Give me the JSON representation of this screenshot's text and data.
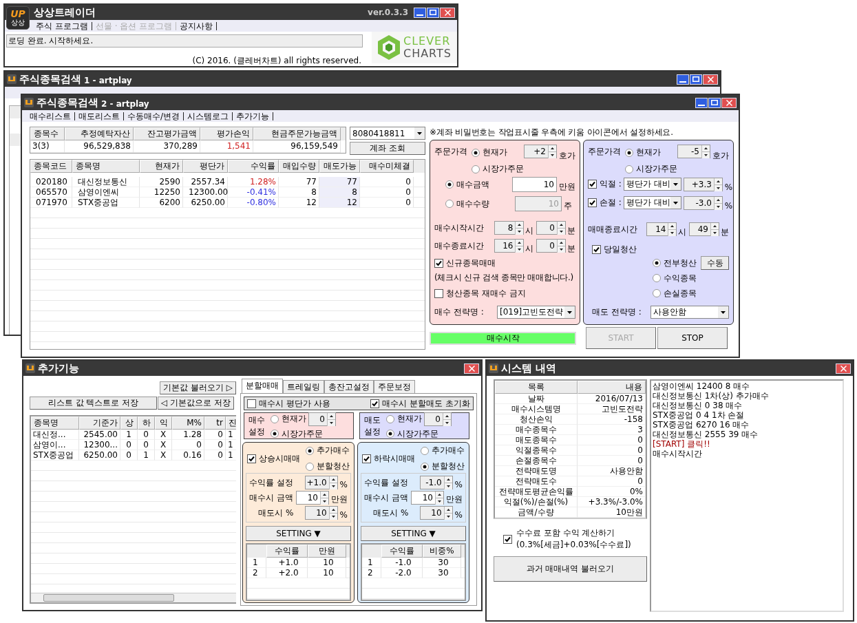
{
  "main_window": {
    "title": "상상트레이더",
    "logo": {
      "mark": "UP",
      "label": "상상"
    },
    "version": "ver.0.3.3",
    "menu": [
      {
        "label": "주식 프로그램",
        "disabled": false
      },
      {
        "label": "선물 · 옵션 프로그램",
        "disabled": true
      },
      {
        "label": "공지사항",
        "disabled": false
      }
    ],
    "status": "로딩 완료. 시작하세요.",
    "copyright": "(C) 2016. (클레버차트) all rights reserved.",
    "brand": [
      "CLEVER",
      "CHARTS"
    ]
  },
  "search_window_1": {
    "title": "주식종목검색",
    "subtitle": "1 - artplay"
  },
  "search_window_2": {
    "title": "주식종목검색",
    "subtitle": "2 - artplay",
    "menu": [
      "매수리스트",
      "매도리스트",
      "수동매수/변경",
      "시스템로그",
      "추가기능"
    ],
    "summary": {
      "columns": [
        "종목수",
        "추정예탁자산",
        "잔고평가금액",
        "평가손익",
        "현금주문가능금액"
      ],
      "values": [
        {
          "text": "3(3)",
          "color": "#000000"
        },
        {
          "text": "96,529,838",
          "color": "#000000"
        },
        {
          "text": "370,289",
          "color": "#000000"
        },
        {
          "text": "1,541",
          "color": "#d02020"
        },
        {
          "text": "96,159,549",
          "color": "#000000"
        }
      ]
    },
    "account": "8080418811",
    "account_button": "계좌 조회",
    "holdings": {
      "columns": [
        {
          "label": "종목코드",
          "kind": "text",
          "highlighted": false
        },
        {
          "label": "종목명",
          "kind": "text",
          "highlighted": false
        },
        {
          "label": "현재가",
          "kind": "number",
          "highlighted": false
        },
        {
          "label": "평단가",
          "kind": "number",
          "highlighted": false
        },
        {
          "label": "수익률",
          "kind": "rate",
          "highlighted": false
        },
        {
          "label": "매입수량",
          "kind": "number",
          "highlighted": false
        },
        {
          "label": "매도가능",
          "kind": "number",
          "highlighted": true
        },
        {
          "label": "매수미체결",
          "kind": "number",
          "highlighted": false
        }
      ],
      "rows": [
        {
          "cells": [
            "020180",
            "대신정보통신",
            "2590",
            "2557.34",
            "1.28%",
            "77",
            "77",
            "0"
          ],
          "color": "#d02020"
        },
        {
          "cells": [
            "065570",
            "삼영이엔씨",
            "12250",
            "12300.00",
            "-0.41%",
            "8",
            "8",
            "0"
          ],
          "color": "#3030e0"
        },
        {
          "cells": [
            "071970",
            "STX중공업",
            "6200",
            "6250.00",
            "-0.80%",
            "12",
            "12",
            "0"
          ],
          "color": "#3030e0"
        }
      ]
    },
    "notice": "※계좌 비밀번호는 작업표시줄 우측에 키움 아이콘에서 설정하세요.",
    "buy_panel": {
      "order_price": {
        "label": "주문가격",
        "options": [
          {
            "label": "현재가",
            "selected": true
          },
          {
            "label": "시장가주문",
            "selected": false
          }
        ],
        "ticks": "+2",
        "unit": "호가"
      },
      "amounts": [
        {
          "label": "매수금액",
          "selected": true,
          "value": "10",
          "unit": "만원",
          "disabled": false
        },
        {
          "label": "매수수량",
          "selected": false,
          "value": "10",
          "unit": "주",
          "disabled": true
        }
      ],
      "times": [
        {
          "label": "매수시작시간",
          "hour": "8",
          "hour_unit": "시",
          "minute": "0",
          "minute_unit": "분"
        },
        {
          "label": "매수종료시간",
          "hour": "16",
          "hour_unit": "시",
          "minute": "0",
          "minute_unit": "분"
        }
      ],
      "new_stock": {
        "label": "신규종목매매",
        "checked": true,
        "note": "(체크시 신규 검색 종목만 매매합니다.)"
      },
      "no_rebuy": {
        "label": "청산종목 재매수 금지",
        "checked": false
      },
      "strategy": {
        "label": "매수 전략명 :",
        "value": "[019]고빈도전략"
      }
    },
    "sell_panel": {
      "order_price": {
        "label": "주문가격",
        "options": [
          {
            "label": "현재가",
            "selected": true
          },
          {
            "label": "시장가주문",
            "selected": false
          }
        ],
        "ticks": "-5",
        "unit": "호가"
      },
      "exits": [
        {
          "label": "익절 :",
          "checked": true,
          "basis": "평단가 대비",
          "value": "+3.3",
          "unit": "%"
        },
        {
          "label": "손절 :",
          "checked": true,
          "basis": "평단가 대비",
          "value": "-3.0",
          "unit": "%"
        }
      ],
      "end_time": {
        "label": "매매종료시간",
        "hour": "14",
        "hour_unit": "시",
        "minute": "49",
        "minute_unit": "분"
      },
      "same_day": {
        "label": "당일청산",
        "checked": true,
        "options": [
          {
            "label": "전부청산",
            "selected": true
          },
          {
            "label": "수익종목",
            "selected": false
          },
          {
            "label": "손실종목",
            "selected": false
          }
        ],
        "manual_button": "수동"
      },
      "strategy": {
        "label": "매도 전략명 :",
        "value": "사용안함"
      }
    },
    "indicator": {
      "label": "매수시작",
      "active": true
    },
    "start_button": {
      "label": "START",
      "disabled": true
    },
    "stop_button": {
      "label": "STOP",
      "disabled": false
    }
  },
  "addon_window": {
    "title": "추가기능",
    "load_button": "기본값 불러오기 ▷",
    "save_list_button": "리스트 값 텍스트로 저장",
    "save_default_button": "◁ 기본값으로 저장",
    "table": {
      "columns": [
        {
          "label": "종목명",
          "kind": "text"
        },
        {
          "label": "기준가",
          "kind": "number"
        },
        {
          "label": "상",
          "kind": "center"
        },
        {
          "label": "하",
          "kind": "center"
        },
        {
          "label": "익",
          "kind": "center"
        },
        {
          "label": "M%",
          "kind": "number"
        },
        {
          "label": "tr",
          "kind": "number"
        },
        {
          "label": "진",
          "kind": "text"
        }
      ],
      "rows": [
        [
          "대신정...",
          "2545.00",
          "1",
          "0",
          "X",
          "1.28",
          "0",
          "1"
        ],
        [
          "삼영이...",
          "12300...",
          "0",
          "0",
          "X",
          "0",
          "0",
          "1"
        ],
        [
          "STX중공업",
          "6250.00",
          "0",
          "1",
          "X",
          "0.16",
          "0",
          "1"
        ]
      ]
    },
    "tabs": [
      {
        "label": "분할매매",
        "selected": true
      },
      {
        "label": "트레일링",
        "selected": false
      },
      {
        "label": "총잔고설정",
        "selected": false
      },
      {
        "label": "주문보정",
        "selected": false
      }
    ],
    "options": [
      {
        "label": "매수시 평단가 사용",
        "checked": false
      },
      {
        "label": "매수시 분할매도 초기화",
        "checked": true
      }
    ],
    "settings": [
      {
        "label": [
          "매수",
          "설정"
        ],
        "options": [
          {
            "label": "현재가",
            "selected": false
          },
          {
            "label": "시장가주문",
            "selected": true
          }
        ],
        "ticks": "0"
      },
      {
        "label": [
          "매도",
          "설정"
        ],
        "options": [
          {
            "label": "현재가",
            "selected": false
          },
          {
            "label": "시장가주문",
            "selected": true
          }
        ],
        "ticks": "0"
      }
    ],
    "splits": [
      {
        "label": "상승시매매",
        "checked": true,
        "options": [
          {
            "label": "추가매수",
            "selected": true
          },
          {
            "label": "분할청산",
            "selected": false
          }
        ],
        "fields": [
          {
            "label": "수익률 설정",
            "value": "+1.0",
            "unit": "%",
            "readonly": true
          },
          {
            "label": "매수시 금액",
            "value": "10",
            "unit": "만원",
            "readonly": false
          },
          {
            "label": "매도시 %",
            "value": "10",
            "unit": "%",
            "readonly": true
          }
        ],
        "setting_button": "SETTING ▼",
        "columns": [
          "",
          "수익률",
          "만원"
        ],
        "rows": [
          [
            "1",
            "+1.0",
            "10"
          ],
          [
            "2",
            "+2.0",
            "10"
          ]
        ]
      },
      {
        "label": "하락시매매",
        "checked": true,
        "options": [
          {
            "label": "추가매수",
            "selected": false
          },
          {
            "label": "분할청산",
            "selected": true
          }
        ],
        "fields": [
          {
            "label": "수익률 설정",
            "value": "-1.0",
            "unit": "%",
            "readonly": true
          },
          {
            "label": "매수시 금액",
            "value": "10",
            "unit": "만원",
            "readonly": false
          },
          {
            "label": "매도시 %",
            "value": "10",
            "unit": "%",
            "readonly": true
          }
        ],
        "setting_button": "SETTING ▼",
        "columns": [
          "",
          "수익률",
          "비중%"
        ],
        "rows": [
          [
            "1",
            "-1.0",
            "30"
          ],
          [
            "2",
            "-2.0",
            "30"
          ]
        ]
      }
    ]
  },
  "system_window": {
    "title": "시스템 내역",
    "columns": [
      "목록",
      "내용"
    ],
    "rows": [
      [
        "날짜",
        "2016/07/13"
      ],
      [
        "매수시스템명",
        "고빈도전략"
      ],
      [
        "청산손익",
        "-158"
      ],
      [
        "매수종목수",
        "3"
      ],
      [
        "매도종목수",
        "0"
      ],
      [
        "익절종목수",
        "0"
      ],
      [
        "손절종목수",
        "0"
      ],
      [
        "전략매도명",
        "사용안함"
      ],
      [
        "전략매도수",
        "0"
      ],
      [
        "전략매도평균손익률",
        "0%"
      ],
      [
        "익절(%)/손절(%)",
        "+3.3%/-3.0%"
      ],
      [
        "금액/수량",
        "10만원"
      ]
    ],
    "fee": {
      "checked": true,
      "label": "수수료 포함 수익 계산하기",
      "detail": "(0.3%[세금]+0.03%[수수료])"
    },
    "history_button": "과거 매매내역 불러오기",
    "log": [
      {
        "text": "삼영이엔씨 12400 8 매수",
        "kind": "message"
      },
      {
        "text": "대신정보통신 1차(상) 추가매수",
        "kind": "message"
      },
      {
        "text": "대신정보통신 0 38 매수",
        "kind": "message"
      },
      {
        "text": "STX중공업 0 4 1차 손절",
        "kind": "message"
      },
      {
        "text": "STX중공업 6270 16 매수",
        "kind": "message"
      },
      {
        "text": "대신정보통신 2555 39 매수",
        "kind": "message"
      },
      {
        "text": "[START] 클릭!!",
        "kind": "alert"
      },
      {
        "text": "매수시작시간",
        "kind": "message"
      }
    ]
  }
}
